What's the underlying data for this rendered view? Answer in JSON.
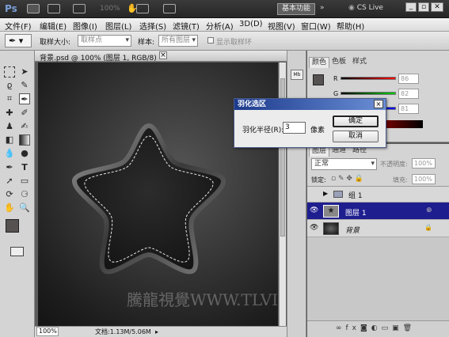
{
  "appbar": {
    "logo": "Ps",
    "zoom": "100%",
    "workspace_button": "基本功能",
    "cslive": "CS Live"
  },
  "menu": [
    "文件(F)",
    "编辑(E)",
    "图像(I)",
    "图层(L)",
    "选择(S)",
    "滤镜(T)",
    "分析(A)",
    "3D(D)",
    "视图(V)",
    "窗口(W)",
    "帮助(H)"
  ],
  "options": {
    "sample_size_label": "取样大小:",
    "sample_size_value": "取样点",
    "sample_label": "样本:",
    "sample_value": "所有图层",
    "show_ring_label": "显示取样环"
  },
  "document": {
    "tab_title": "背景.psd @ 100% (图层 1, RGB/8) *",
    "watermark": "騰龍視覺WWW.TLVI.NET"
  },
  "status": {
    "zoom": "100%",
    "doc_info": "文档:1.13M/5.06M"
  },
  "color_panel": {
    "tabs": [
      "颜色",
      "色板",
      "样式"
    ],
    "channels": [
      {
        "label": "R",
        "value": "86"
      },
      {
        "label": "G",
        "value": "82"
      },
      {
        "label": "B",
        "value": "81"
      }
    ]
  },
  "layers_panel": {
    "tabs": [
      "图层",
      "通道",
      "路径"
    ],
    "blend_mode": "正常",
    "opacity_label": "不透明度:",
    "opacity_value": "100%",
    "lock_label": "锁定:",
    "fill_label": "填充:",
    "fill_value": "100%",
    "layers": [
      {
        "name": "组 1",
        "type": "group",
        "selected": false
      },
      {
        "name": "图层 1",
        "type": "layer",
        "selected": true
      },
      {
        "name": "背景",
        "type": "background",
        "selected": false
      }
    ]
  },
  "dialog": {
    "title": "羽化选区",
    "radius_label": "羽化半径(R):",
    "radius_value": "3",
    "unit": "像素",
    "ok": "确定",
    "cancel": "取消"
  },
  "colors": {
    "foreground": "#565251",
    "background": "#ffffff",
    "selected_layer": "#1e1e8f"
  }
}
